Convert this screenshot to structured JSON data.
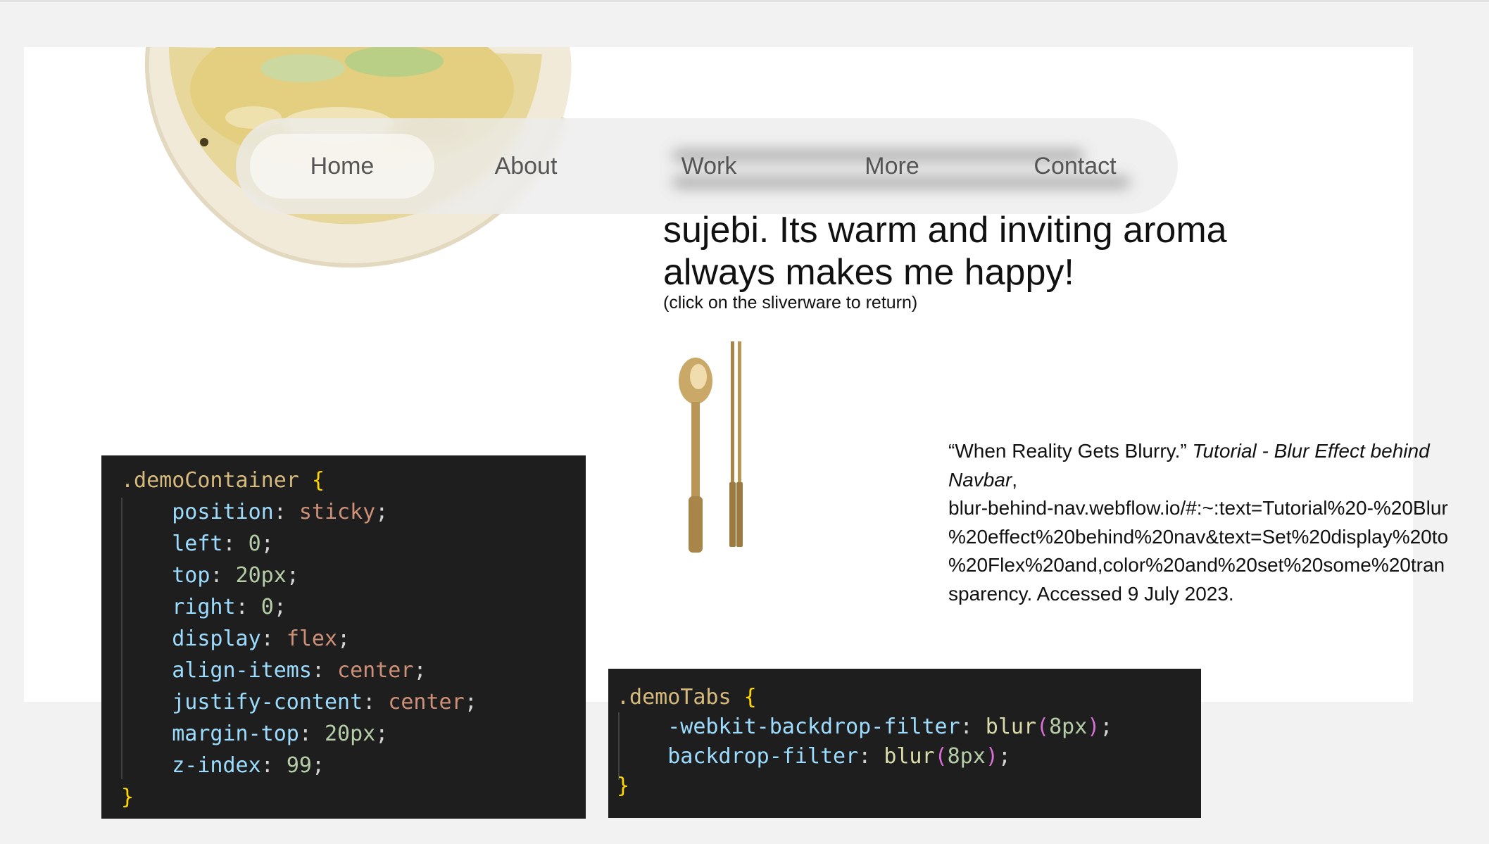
{
  "navbar": {
    "items": [
      {
        "label": "Home",
        "active": true
      },
      {
        "label": "About",
        "active": false
      },
      {
        "label": "Work",
        "active": false
      },
      {
        "label": "More",
        "active": false
      },
      {
        "label": "Contact",
        "active": false
      }
    ]
  },
  "article": {
    "lines": [
      "sujebi. Its warm and inviting aroma",
      "always makes me happy!"
    ],
    "hint": "(click on the sliverware to return)"
  },
  "citation": {
    "title": "“When Reality Gets Blurry.”",
    "source": "Tutorial - Blur Effect behind",
    "source_cont": "Navbar",
    "comma": ",",
    "url_lines": [
      "blur-behind-nav.webflow.io/#:~:text=Tutorial%20-%20Blur",
      "%20effect%20behind%20nav&text=Set%20display%20to",
      "%20Flex%20and,color%20and%20set%20some%20tran",
      "sparency. Accessed 9 July 2023."
    ]
  },
  "code_container": {
    "selector": ".demoContainer",
    "rules": [
      {
        "prop": "position",
        "value": "sticky",
        "kind": "str"
      },
      {
        "prop": "left",
        "value": "0",
        "kind": "num"
      },
      {
        "prop": "top",
        "value": "20px",
        "kind": "num"
      },
      {
        "prop": "right",
        "value": "0",
        "kind": "num"
      },
      {
        "prop": "display",
        "value": "flex",
        "kind": "str"
      },
      {
        "prop": "align-items",
        "value": "center",
        "kind": "str"
      },
      {
        "prop": "justify-content",
        "value": "center",
        "kind": "str"
      },
      {
        "prop": "margin-top",
        "value": "20px",
        "kind": "num"
      },
      {
        "prop": "z-index",
        "value": "99",
        "kind": "num"
      }
    ]
  },
  "code_tabs": {
    "selector": ".demoTabs",
    "rules": [
      {
        "prop": "-webkit-backdrop-filter",
        "fn": "blur",
        "arg": "8px"
      },
      {
        "prop": "backdrop-filter",
        "fn": "blur",
        "arg": "8px"
      }
    ]
  }
}
